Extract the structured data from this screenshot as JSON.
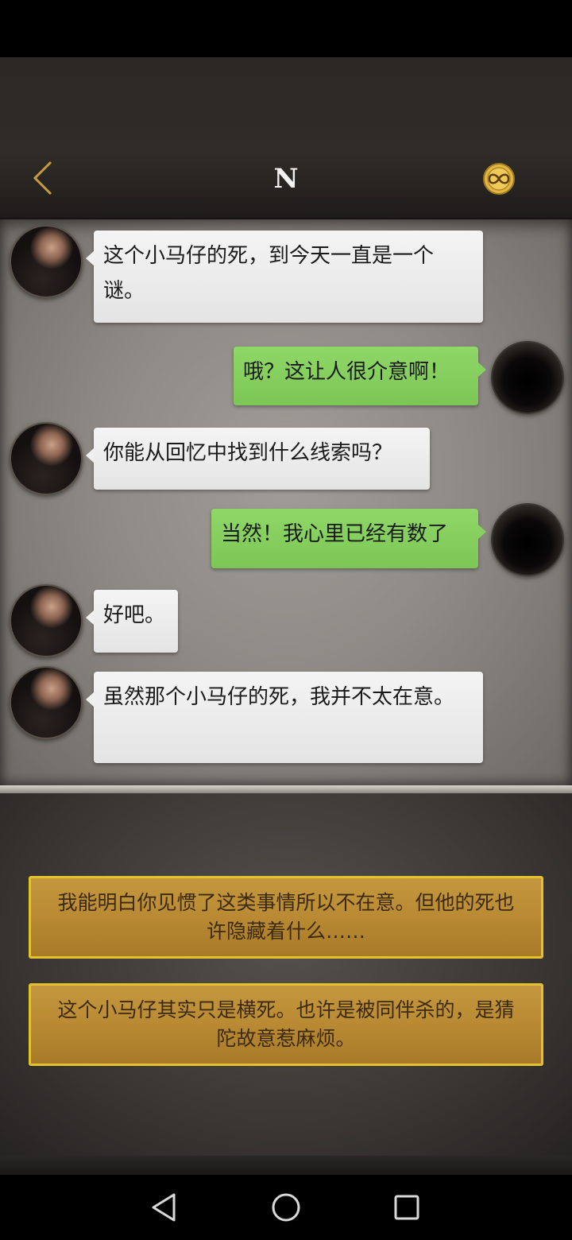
{
  "header": {
    "title": "N"
  },
  "icons": {
    "back": "chevron-left-icon",
    "coin": "coin-infinity-icon"
  },
  "messages": [
    {
      "sender": "npc",
      "text": "这个小马仔的死，到今天一直是一个谜。"
    },
    {
      "sender": "player",
      "text": "哦？这让人很介意啊！"
    },
    {
      "sender": "npc",
      "text": "你能从回忆中找到什么线索吗？"
    },
    {
      "sender": "player",
      "text": "当然！我心里已经有数了"
    },
    {
      "sender": "npc",
      "text": "好吧。"
    },
    {
      "sender": "npc",
      "text": "虽然那个小马仔的死，我并不太在意。"
    }
  ],
  "choices": [
    {
      "text": "我能明白你见惯了这类事情所以不在意。但他的死也许隐藏着什么……"
    },
    {
      "text": "这个小马仔其实只是横死。也许是被同伴杀的，是猜陀故意惹麻烦。"
    }
  ],
  "colors": {
    "npc_bubble": "#f0f0f0",
    "player_bubble": "#86d05f",
    "choice_bg": "#b98a33",
    "choice_border": "#e4c22e"
  }
}
